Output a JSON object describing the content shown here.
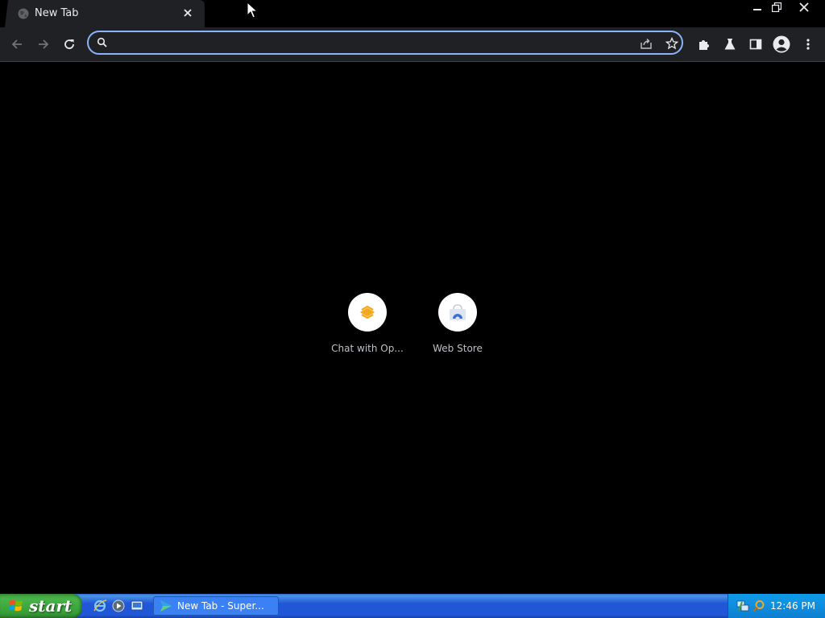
{
  "browser": {
    "tab": {
      "title": "New Tab"
    },
    "omnibox": {
      "value": "",
      "placeholder": ""
    }
  },
  "shortcuts": [
    {
      "label": "Chat with Op...",
      "icon": "openai-chat-icon"
    },
    {
      "label": "Web Store",
      "icon": "web-store-icon"
    }
  ],
  "taskbar": {
    "start_label": "start",
    "task_label": "New Tab - Super...",
    "clock": "12:46 PM"
  },
  "colors": {
    "accent": "#8ab4f8",
    "xp_blue": "#2157d7",
    "xp_green": "#48b548"
  }
}
